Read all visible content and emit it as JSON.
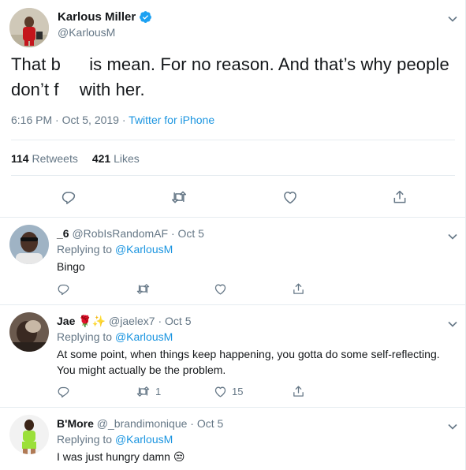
{
  "main_tweet": {
    "name": "Karlous Miller",
    "handle": "@KarlousM",
    "text_part1": "That b",
    "text_part2": " is mean. For no reason. And that’s why people don’t f",
    "text_part3": " with her.",
    "timestamp": "6:16 PM · Oct 5, 2019",
    "separator": " · ",
    "source": "Twitter for iPhone",
    "retweets_count": "114",
    "retweets_label": "Retweets",
    "likes_count": "421",
    "likes_label": "Likes"
  },
  "replies": [
    {
      "name": "_6",
      "handle": "@RobIsRandomAF",
      "date": "Oct 5",
      "replying_label": "Replying to",
      "replying_to": "@KarlousM",
      "text": "Bingo",
      "reply_count": "",
      "retweet_count": "",
      "like_count": ""
    },
    {
      "name": "Jae",
      "name_emoji": "🌹✨",
      "handle": "@jaelex7",
      "date": "Oct 5",
      "replying_label": "Replying to",
      "replying_to": "@KarlousM",
      "text": "At some point, when things keep happening, you gotta do some self-reflecting. You might actually be the problem.",
      "reply_count": "",
      "retweet_count": "1",
      "like_count": "15"
    },
    {
      "name": "B'More",
      "handle": "@_brandimonique",
      "date": "Oct 5",
      "replying_label": "Replying to",
      "replying_to": "@KarlousM",
      "text": "I was just hungry damn",
      "text_emoji": "😒"
    }
  ],
  "icons": {
    "verified": "verified-badge-icon",
    "chevron": "chevron-down-icon",
    "reply": "reply-icon",
    "retweet": "retweet-icon",
    "like": "like-icon",
    "share": "share-icon"
  },
  "colors": {
    "accent": "#1b95e0",
    "secondary_text": "#657786",
    "divider": "#e6ecf0"
  }
}
